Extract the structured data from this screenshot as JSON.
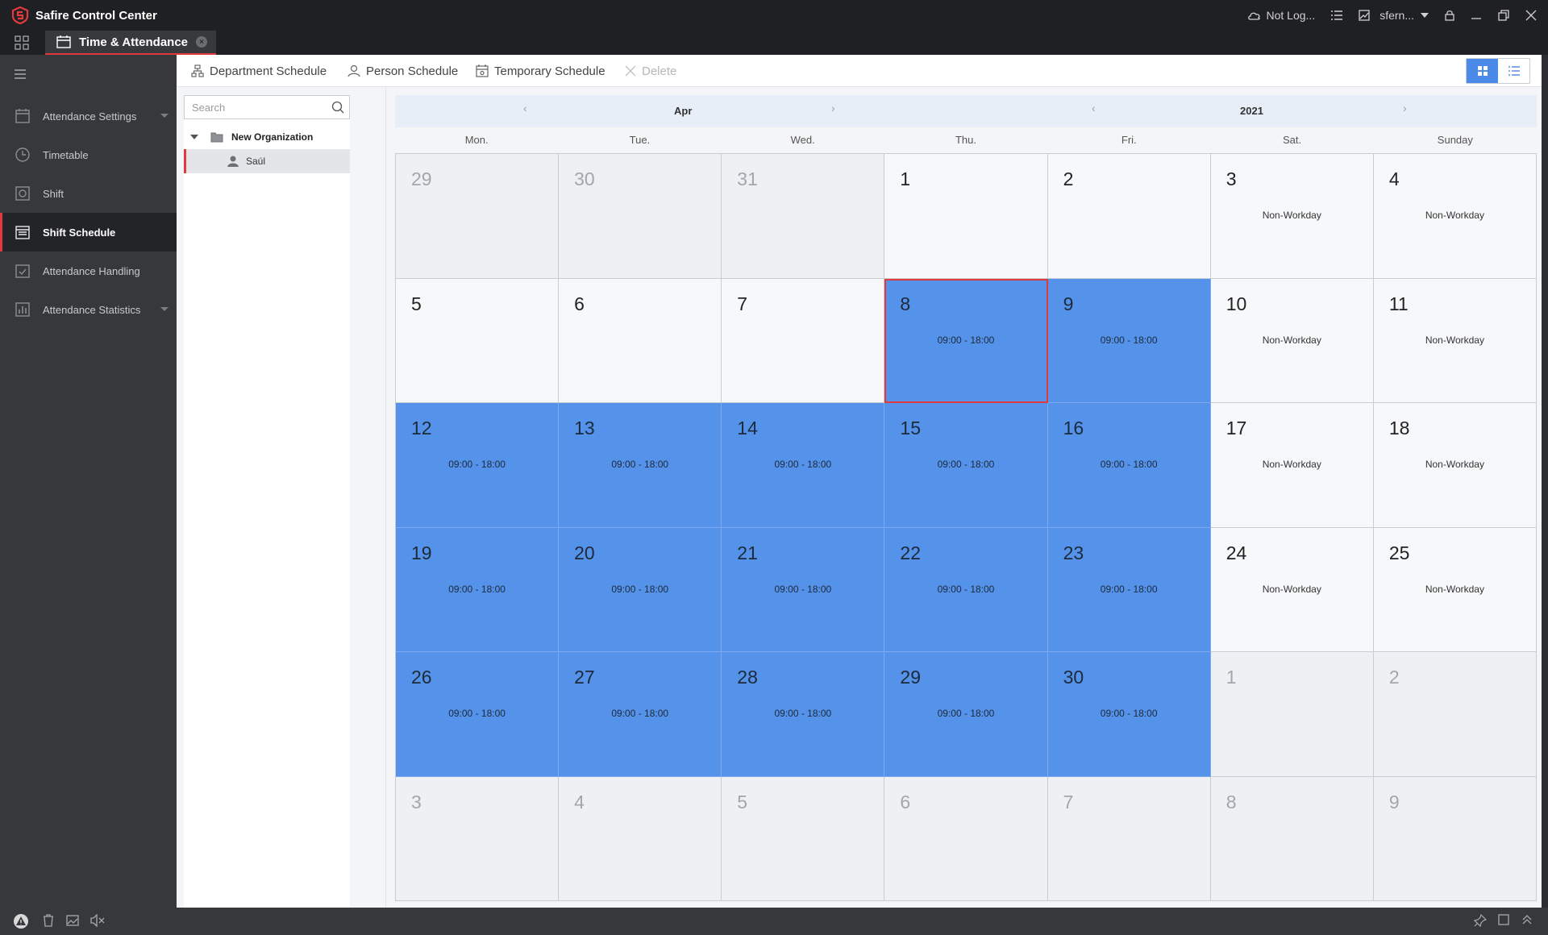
{
  "app": {
    "title": "Safire Control Center"
  },
  "titlebar": {
    "cloud_status": "Not Log...",
    "user": "sfern..."
  },
  "tab": {
    "label": "Time & Attendance"
  },
  "sidebar": {
    "items": [
      {
        "label": "Attendance Settings"
      },
      {
        "label": "Timetable"
      },
      {
        "label": "Shift"
      },
      {
        "label": "Shift Schedule"
      },
      {
        "label": "Attendance Handling"
      },
      {
        "label": "Attendance Statistics"
      }
    ]
  },
  "toolbar": {
    "department_schedule": "Department Schedule",
    "person_schedule": "Person Schedule",
    "temporary_schedule": "Temporary Schedule",
    "delete": "Delete"
  },
  "tree": {
    "search_placeholder": "Search",
    "organization": "New Organization",
    "person": "Saúl"
  },
  "calendar": {
    "month": "Apr",
    "year": "2021",
    "weekdays": [
      "Mon.",
      "Tue.",
      "Wed.",
      "Thu.",
      "Fri.",
      "Sat.",
      "Sunday"
    ],
    "shift_text": "09:00 - 18:00",
    "nonwork_text": "Non-Workday",
    "days": [
      {
        "d": "29",
        "t": "other"
      },
      {
        "d": "30",
        "t": "other"
      },
      {
        "d": "31",
        "t": "other"
      },
      {
        "d": "1",
        "t": "empty"
      },
      {
        "d": "2",
        "t": "empty"
      },
      {
        "d": "3",
        "t": "nonwork"
      },
      {
        "d": "4",
        "t": "nonwork"
      },
      {
        "d": "5",
        "t": "empty"
      },
      {
        "d": "6",
        "t": "empty"
      },
      {
        "d": "7",
        "t": "empty"
      },
      {
        "d": "8",
        "t": "sched",
        "selected": true
      },
      {
        "d": "9",
        "t": "sched"
      },
      {
        "d": "10",
        "t": "nonwork"
      },
      {
        "d": "11",
        "t": "nonwork"
      },
      {
        "d": "12",
        "t": "sched"
      },
      {
        "d": "13",
        "t": "sched"
      },
      {
        "d": "14",
        "t": "sched"
      },
      {
        "d": "15",
        "t": "sched"
      },
      {
        "d": "16",
        "t": "sched"
      },
      {
        "d": "17",
        "t": "nonwork"
      },
      {
        "d": "18",
        "t": "nonwork"
      },
      {
        "d": "19",
        "t": "sched"
      },
      {
        "d": "20",
        "t": "sched"
      },
      {
        "d": "21",
        "t": "sched"
      },
      {
        "d": "22",
        "t": "sched"
      },
      {
        "d": "23",
        "t": "sched"
      },
      {
        "d": "24",
        "t": "nonwork"
      },
      {
        "d": "25",
        "t": "nonwork"
      },
      {
        "d": "26",
        "t": "sched"
      },
      {
        "d": "27",
        "t": "sched"
      },
      {
        "d": "28",
        "t": "sched"
      },
      {
        "d": "29",
        "t": "sched"
      },
      {
        "d": "30",
        "t": "sched"
      },
      {
        "d": "1",
        "t": "other"
      },
      {
        "d": "2",
        "t": "other"
      },
      {
        "d": "3",
        "t": "other"
      },
      {
        "d": "4",
        "t": "other"
      },
      {
        "d": "5",
        "t": "other"
      },
      {
        "d": "6",
        "t": "other"
      },
      {
        "d": "7",
        "t": "other"
      },
      {
        "d": "8",
        "t": "other"
      },
      {
        "d": "9",
        "t": "other"
      }
    ]
  },
  "colors": {
    "accent": "#e0393e",
    "schedule": "#5592ea"
  }
}
